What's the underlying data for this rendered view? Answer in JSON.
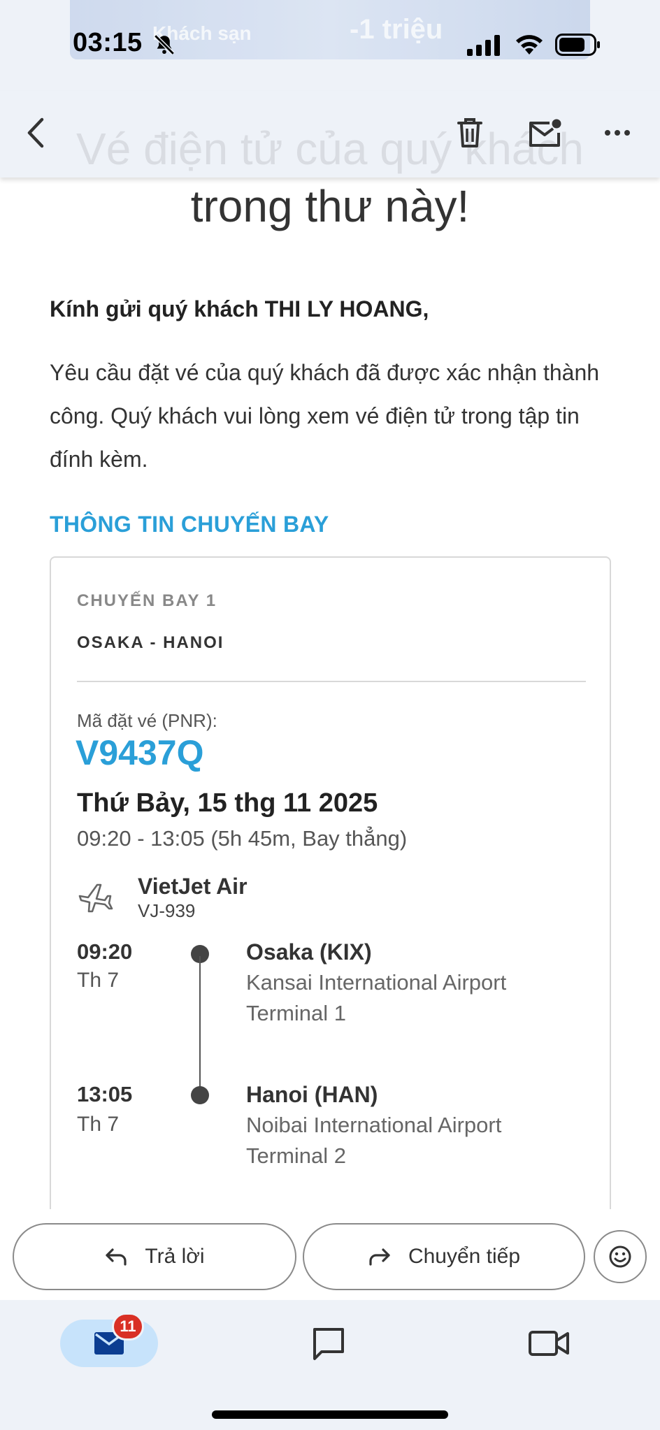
{
  "status_bar": {
    "time": "03:15",
    "banner_left": "Khách sạn",
    "banner_right": "-1 triệu"
  },
  "header": {
    "ghost_title": "Vé điện tử của quý khách",
    "icons": [
      "back-arrow-icon",
      "trash-icon",
      "mark-unread-icon",
      "more-icon"
    ]
  },
  "email": {
    "headline": "trong thư này!",
    "greeting": "Kính gửi quý khách THI LY HOANG,",
    "intro": "Yêu cầu đặt vé của quý khách đã được xác nhận thành công. Quý khách vui lòng xem vé điện tử trong tập tin đính kèm.",
    "section_title": "THÔNG TIN CHUYẾN BAY"
  },
  "flight": {
    "label": "CHUYẾN BAY 1",
    "route": "OSAKA - HANOI",
    "pnr_label": "Mã đặt vé (PNR):",
    "pnr": "V9437Q",
    "date": "Thứ Bảy, 15 thg 11 2025",
    "times": "09:20 - 13:05 (5h 45m, Bay thẳng)",
    "airline": "VietJet Air",
    "flight_code": "VJ-939",
    "departure": {
      "time": "09:20",
      "day": "Th 7",
      "city": "Osaka (KIX)",
      "airport": "Kansai International Airport",
      "terminal": "Terminal 1"
    },
    "arrival": {
      "time": "13:05",
      "day": "Th 7",
      "city": "Hanoi (HAN)",
      "airport": "Noibai International Airport",
      "terminal": "Terminal 2"
    }
  },
  "actions": {
    "reply": "Trả lời",
    "forward": "Chuyển tiếp"
  },
  "bottom_nav": {
    "mail_badge": "11"
  },
  "colors": {
    "accent": "#2a9fd8",
    "nav_bg": "#eef2f8",
    "mail_pill": "#c7e3fb",
    "badge": "#d93025"
  }
}
